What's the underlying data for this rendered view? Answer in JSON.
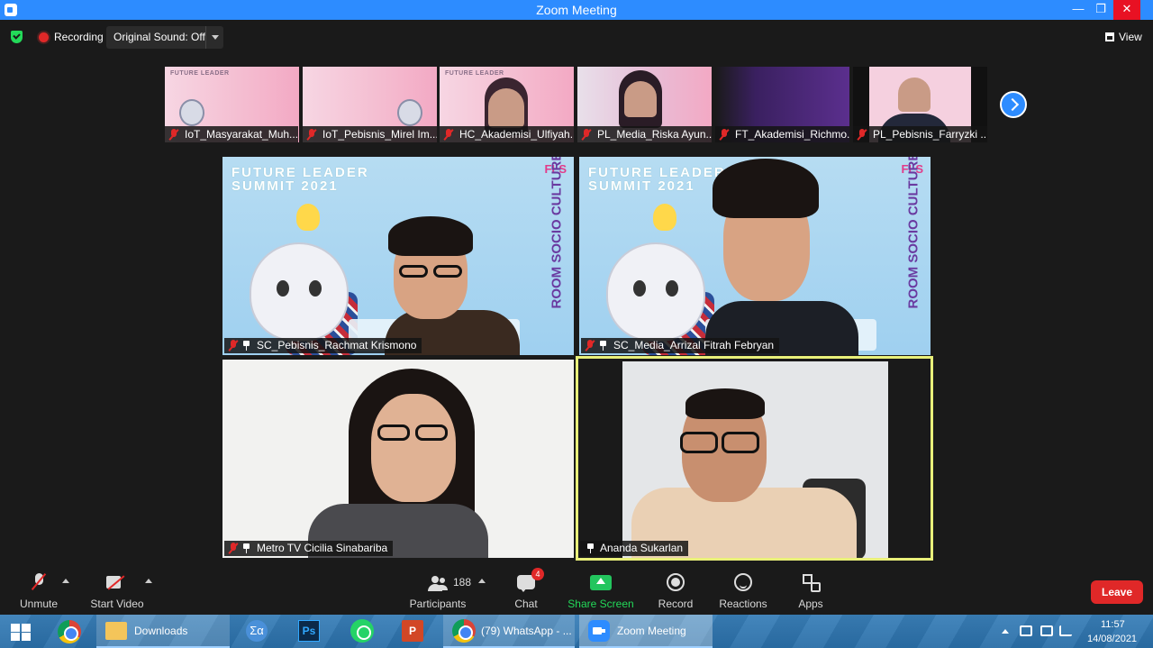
{
  "window": {
    "title": "Zoom Meeting"
  },
  "infobar": {
    "recording_label": "Recording",
    "original_sound_label": "Original Sound: Off",
    "view_label": "View"
  },
  "strip": [
    {
      "name": "IoT_Masyarakat_Muh...",
      "bg": "pink"
    },
    {
      "name": "IoT_Pebisnis_Mirel Im...",
      "bg": "pink"
    },
    {
      "name": "HC_Akademisi_Ulfiyah...",
      "bg": "pink"
    },
    {
      "name": "PL_Media_Riska Ayun...",
      "bg": "mixed"
    },
    {
      "name": "FT_Akademisi_Richmo...",
      "bg": "dark"
    },
    {
      "name": "PL_Pebisnis_Farryzki ...",
      "bg": "pink"
    }
  ],
  "poster": {
    "title_line1": "FUTURE LEADER",
    "title_line2": "SUMMIT 2021",
    "logo": "FLS",
    "room": "ROOM SOCIO CULTURE"
  },
  "tiles": [
    {
      "name": "SC_Pebisnis_Rachmat Krismono"
    },
    {
      "name": "SC_Media_Arrizal Fitrah Febryan"
    },
    {
      "name": "Metro TV Cicilia Sinabariba"
    },
    {
      "name": "Ananda Sukarlan"
    }
  ],
  "toolbar": {
    "unmute": "Unmute",
    "start_video": "Start Video",
    "participants": "Participants",
    "participant_count": "188",
    "chat": "Chat",
    "chat_badge": "4",
    "share_screen": "Share Screen",
    "record": "Record",
    "reactions": "Reactions",
    "apps": "Apps",
    "leave": "Leave"
  },
  "taskbar": {
    "downloads": "Downloads",
    "ps": "Ps",
    "ppt": "P",
    "sigma": "Σα",
    "whatsapp": "(79) WhatsApp - ...",
    "zoom": "Zoom Meeting",
    "time": "11:57",
    "date": "14/08/2021"
  },
  "colors": {
    "zoom_blue": "#2d8cff",
    "leave_red": "#e02828",
    "share_green": "#23c55e",
    "active_speaker": "#e9f07a"
  }
}
